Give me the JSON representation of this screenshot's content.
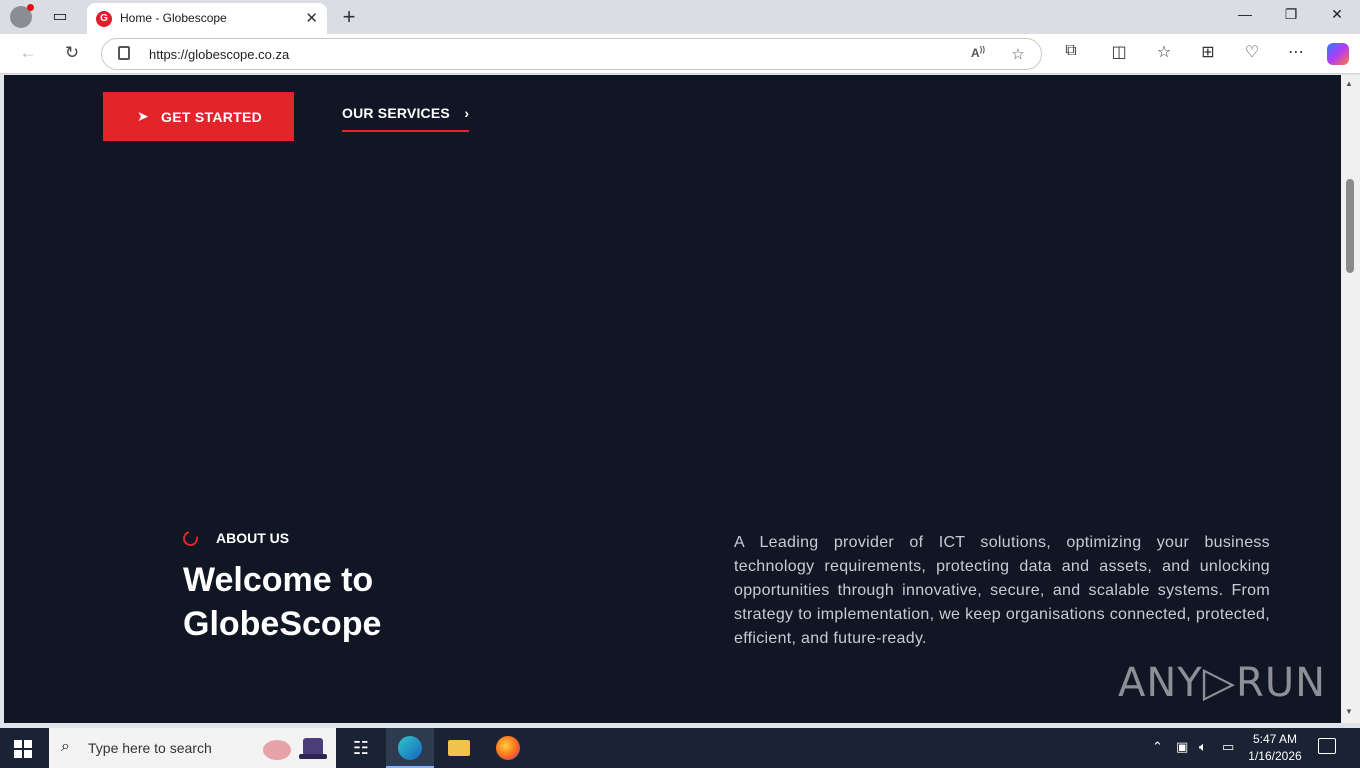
{
  "browser": {
    "tab": {
      "favicon": "G",
      "title": "Home - Globescope"
    },
    "address": {
      "url": "https://globescope.co.za"
    },
    "window_controls": {
      "minimize": "—",
      "restore": "❐",
      "close": "✕"
    }
  },
  "page": {
    "cta": {
      "label": "GET STARTED",
      "icon": "paper-plane-icon"
    },
    "services_link": {
      "label": "OUR SERVICES",
      "chevron": "›"
    },
    "about": {
      "label": "ABOUT US",
      "headline": "Welcome to GlobeScope",
      "description": "A Leading provider of ICT solutions, optimizing your business technology requirements, protecting data and assets, and unlocking opportunities through innovative, secure, and scalable systems. From strategy to implementation, we keep organisations connected, protected, efficient, and future-ready."
    },
    "watermark": {
      "left": "ANY",
      "right": "RUN"
    },
    "colors": {
      "accent": "#e4242b",
      "background": "#111624"
    }
  },
  "taskbar": {
    "search_placeholder": "Type here to search",
    "clock": {
      "time": "5:47 AM",
      "date": "1/16/2026"
    }
  }
}
